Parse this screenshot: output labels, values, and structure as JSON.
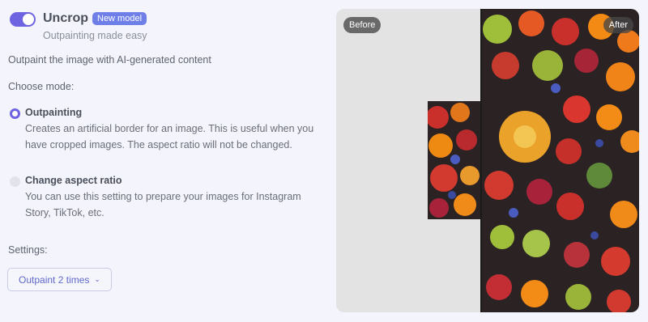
{
  "header": {
    "title": "Uncrop",
    "badge": "New model",
    "subtitle": "Outpainting made easy",
    "toggle_on": true
  },
  "description": "Outpaint the image with AI-generated content",
  "mode_label": "Choose mode:",
  "modes": [
    {
      "title": "Outpainting",
      "description": "Creates an artificial border for an image. This is useful when you have cropped images. The aspect ratio will not be changed.",
      "selected": true
    },
    {
      "title": "Change aspect ratio",
      "description": "You can use this setting to prepare your images for Instagram Story, TikTok, etc.",
      "selected": false
    }
  ],
  "settings": {
    "label": "Settings:",
    "selected_option": "Outpaint 2 times"
  },
  "comparison": {
    "before_label": "Before",
    "after_label": "After"
  },
  "colors": {
    "accent": "#6e64e2",
    "badge": "#6e7fe8",
    "background": "#f3f4fc"
  }
}
